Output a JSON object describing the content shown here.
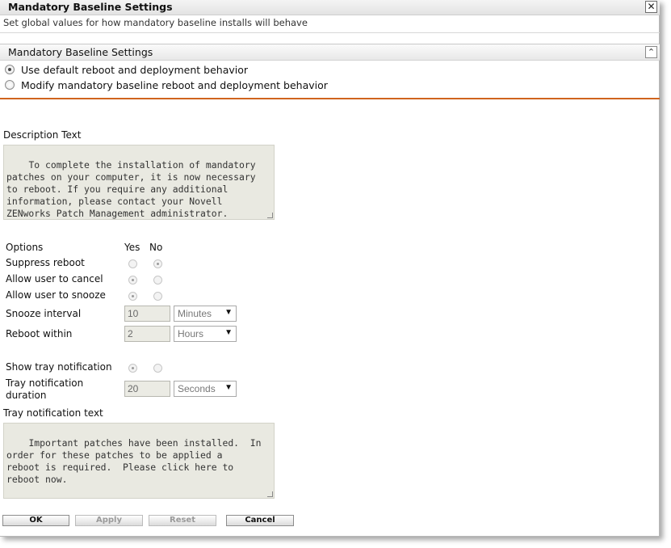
{
  "dialog": {
    "title": "Mandatory Baseline Settings",
    "subtitle": "Set global values for how mandatory baseline installs will behave",
    "close_glyph": "✕"
  },
  "section": {
    "title": "Mandatory Baseline Settings",
    "collapse_glyph": "⌃",
    "radio_default": "Use default reboot and deployment behavior",
    "radio_modify": "Modify mandatory baseline reboot and deployment behavior",
    "selected": "default"
  },
  "description": {
    "label": "Description Text",
    "text": "To complete the installation of mandatory\npatches on your computer, it is now necessary\nto reboot. If you require any additional\ninformation, please contact your Novell\nZENworks Patch Management administrator."
  },
  "options": {
    "header": "Options",
    "yes": "Yes",
    "no": "No",
    "suppress_reboot": "Suppress reboot",
    "allow_cancel": "Allow user to cancel",
    "allow_snooze": "Allow user to snooze",
    "snooze_interval": "Snooze interval",
    "snooze_value": "10",
    "snooze_unit": "Minutes",
    "reboot_within": "Reboot within",
    "reboot_value": "2",
    "reboot_unit": "Hours",
    "show_tray": "Show tray notification",
    "tray_duration_line1": "Tray notification",
    "tray_duration_line2": "duration",
    "tray_value": "20",
    "tray_unit": "Seconds"
  },
  "tray_text": {
    "label": "Tray notification text",
    "text": "Important patches have been installed.  In\norder for these patches to be applied a\nreboot is required.  Please click here to\nreboot now."
  },
  "buttons": {
    "ok": "OK",
    "apply": "Apply",
    "reset": "Reset",
    "cancel": "Cancel"
  },
  "colors": {
    "accent": "#d0641e"
  }
}
